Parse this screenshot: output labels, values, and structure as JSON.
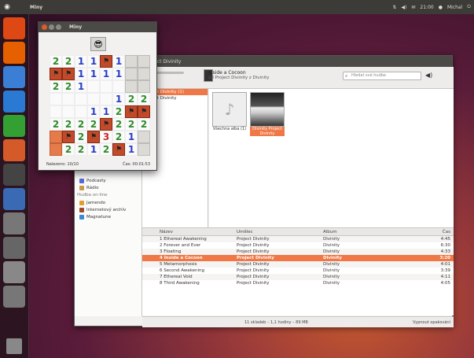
{
  "top_panel": {
    "app_title": "Miny",
    "clock": "21:00",
    "user": "Michal",
    "right_icons": [
      "network-icon",
      "volume-icon",
      "mail-icon",
      "user-icon",
      "power-icon"
    ]
  },
  "launcher": {
    "items": [
      {
        "name": "ubuntu-software-icon",
        "color": "#dd4814"
      },
      {
        "name": "firefox-icon",
        "color": "#e66000"
      },
      {
        "name": "files-icon",
        "color": "#3a7fd5"
      },
      {
        "name": "libreoffice-writer-icon",
        "color": "#2a7ad4"
      },
      {
        "name": "libreoffice-calc-icon",
        "color": "#33a033"
      },
      {
        "name": "libreoffice-impress-icon",
        "color": "#d45a2a"
      },
      {
        "name": "terminal-icon",
        "color": "#444444"
      },
      {
        "name": "rhythmbox-icon",
        "color": "#3a6ab4"
      },
      {
        "name": "mines-icon",
        "color": "#777777"
      },
      {
        "name": "app-icon-generic",
        "color": "#666666"
      },
      {
        "name": "settings-icon",
        "color": "#888888"
      },
      {
        "name": "workspace-icon",
        "color": "#777777"
      }
    ]
  },
  "player": {
    "window_title": "Project Divinity",
    "now_playing": {
      "title": "Inside a Cocoon",
      "subtitle": "od Project Divinity z Divinity"
    },
    "search_placeholder": "Hledat své hudbe",
    "sidebar": {
      "items": [
        {
          "label": "Podcasty",
          "icon": "podcast-icon",
          "color": "#5a6ad4"
        },
        {
          "label": "Rádio",
          "icon": "radio-icon",
          "color": "#c89a4a"
        }
      ],
      "online_section": "Hudba on-line",
      "online_items": [
        {
          "label": "Jamendo",
          "icon": "jamendo-icon",
          "color": "#e0a030"
        },
        {
          "label": "Internetový archív",
          "icon": "archive-icon",
          "color": "#a04a2a"
        },
        {
          "label": "Magnatune",
          "icon": "magnatune-icon",
          "color": "#3a8ad4"
        }
      ]
    },
    "browser": {
      "artists": [
        {
          "label": "Project Divinity (1)",
          "selected": true
        },
        {
          "label": "Project Divinity",
          "selected": false
        }
      ],
      "albums": [
        {
          "caption": "Všechna alba (1)",
          "selected": false
        },
        {
          "caption": "Divinity Project Divinity",
          "selected": true
        }
      ]
    },
    "columns": [
      "Název",
      "Umělec",
      "Album",
      "Čas"
    ],
    "tracks": [
      {
        "name": "1 Ethereal Awakening",
        "artist": "Project Divinity",
        "album": "Divinity",
        "time": "4:45",
        "playing": false
      },
      {
        "name": "2 Forever and Ever",
        "artist": "Project Divinity",
        "album": "Divinity",
        "time": "6:30",
        "playing": false
      },
      {
        "name": "3 Floating",
        "artist": "Project Divinity",
        "album": "Divinity",
        "time": "4:33",
        "playing": false
      },
      {
        "name": "4 Inside a Cocoon",
        "artist": "Project Divinity",
        "album": "Divinity",
        "time": "3:20",
        "playing": true
      },
      {
        "name": "5 Metamorphosis",
        "artist": "Project Divinity",
        "album": "Divinity",
        "time": "4:01",
        "playing": false
      },
      {
        "name": "6 Second Awakening",
        "artist": "Project Divinity",
        "album": "Divinity",
        "time": "3:39",
        "playing": false
      },
      {
        "name": "7 Ethereal Void",
        "artist": "Project Divinity",
        "album": "Divinity",
        "time": "4:11",
        "playing": false
      },
      {
        "name": "8 Third Awakening",
        "artist": "Project Divinity",
        "album": "Divinity",
        "time": "4:05",
        "playing": false
      }
    ],
    "status": {
      "summary": "11 skladeb – 1,1 hodiny – 89 MB",
      "right": "Vypnout opakování"
    }
  },
  "mines": {
    "window_title": "Miny",
    "face": "😎",
    "grid": [
      [
        "2",
        "2",
        "1",
        "1",
        "F",
        "1",
        "",
        ""
      ],
      [
        "F",
        "F",
        "1",
        "1",
        "1",
        "1",
        "",
        ""
      ],
      [
        "2",
        "2",
        "1",
        "",
        "",
        "",
        "",
        ""
      ],
      [
        "",
        "",
        "",
        "",
        "",
        "1",
        "2",
        "2"
      ],
      [
        "",
        "",
        "",
        "1",
        "1",
        "2",
        "F",
        "F"
      ],
      [
        "2",
        "2",
        "2",
        "2",
        "F",
        "2",
        "2",
        "2"
      ],
      [
        "H",
        "F",
        "2",
        "F",
        "3",
        "2",
        "1",
        ""
      ],
      [
        "H",
        "2",
        "2",
        "1",
        "2",
        "F",
        "1",
        ""
      ]
    ],
    "footer_left": "Nalezeno: 10/10",
    "footer_right": "Čas: 00:01:53"
  }
}
